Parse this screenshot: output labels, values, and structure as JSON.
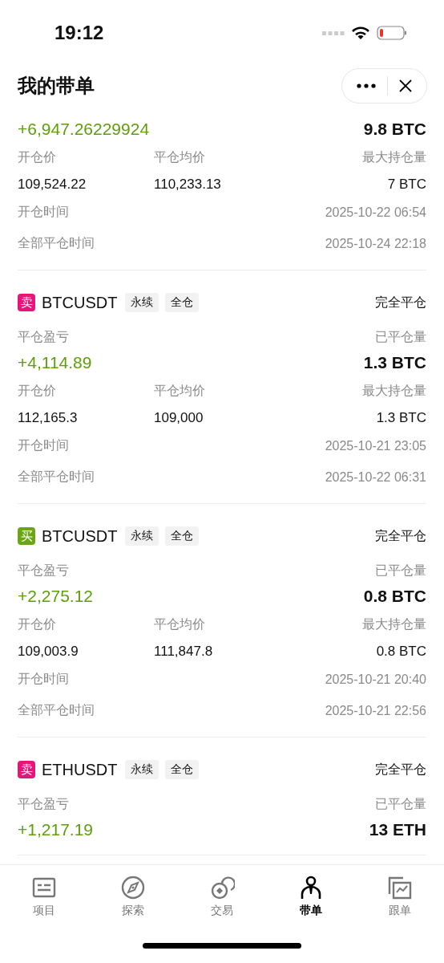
{
  "status_bar": {
    "time": "19:12"
  },
  "header": {
    "title": "我的带单"
  },
  "orders": [
    {
      "pnl": "+6,947.26229924",
      "closed_qty": "9.8 BTC",
      "fields": [
        {
          "label": "开仓价",
          "value": "109,524.22"
        },
        {
          "label": "平仓均价",
          "value": "110,233.13"
        },
        {
          "label": "最大持仓量",
          "value": "7 BTC"
        }
      ],
      "times": [
        {
          "label": "开仓时间",
          "value": "2025-10-22 06:54"
        },
        {
          "label": "全部平仓时间",
          "value": "2025-10-24 22:18"
        }
      ]
    },
    {
      "side": {
        "kind": "sell",
        "label": "卖"
      },
      "symbol": "BTCUSDT",
      "tags": [
        "永续",
        "全仓"
      ],
      "status": "完全平仓",
      "pnl_label": "平仓盈亏",
      "qty_label": "已平仓量",
      "pnl": "+4,114.89",
      "closed_qty": "1.3 BTC",
      "fields": [
        {
          "label": "开仓价",
          "value": "112,165.3"
        },
        {
          "label": "平仓均价",
          "value": "109,000"
        },
        {
          "label": "最大持仓量",
          "value": "1.3 BTC"
        }
      ],
      "times": [
        {
          "label": "开仓时间",
          "value": "2025-10-21 23:05"
        },
        {
          "label": "全部平仓时间",
          "value": "2025-10-22 06:31"
        }
      ]
    },
    {
      "side": {
        "kind": "buy",
        "label": "买"
      },
      "symbol": "BTCUSDT",
      "tags": [
        "永续",
        "全仓"
      ],
      "status": "完全平仓",
      "pnl_label": "平仓盈亏",
      "qty_label": "已平仓量",
      "pnl": "+2,275.12",
      "closed_qty": "0.8 BTC",
      "fields": [
        {
          "label": "开仓价",
          "value": "109,003.9"
        },
        {
          "label": "平仓均价",
          "value": "111,847.8"
        },
        {
          "label": "最大持仓量",
          "value": "0.8 BTC"
        }
      ],
      "times": [
        {
          "label": "开仓时间",
          "value": "2025-10-21 20:40"
        },
        {
          "label": "全部平仓时间",
          "value": "2025-10-21 22:56"
        }
      ]
    },
    {
      "side": {
        "kind": "sell",
        "label": "卖"
      },
      "symbol": "ETHUSDT",
      "tags": [
        "永续",
        "全仓"
      ],
      "status": "完全平仓",
      "pnl_label": "平仓盈亏",
      "qty_label": "已平仓量",
      "pnl": "+1,217.19",
      "closed_qty": "13 ETH"
    }
  ],
  "tab_bar": [
    {
      "kind": "list",
      "label": "项目",
      "selected": false
    },
    {
      "kind": "compass",
      "label": "探索",
      "selected": false
    },
    {
      "kind": "coins",
      "label": "交易",
      "selected": false
    },
    {
      "kind": "person",
      "label": "带单",
      "selected": true
    },
    {
      "kind": "chart",
      "label": "跟单",
      "selected": false
    }
  ]
}
